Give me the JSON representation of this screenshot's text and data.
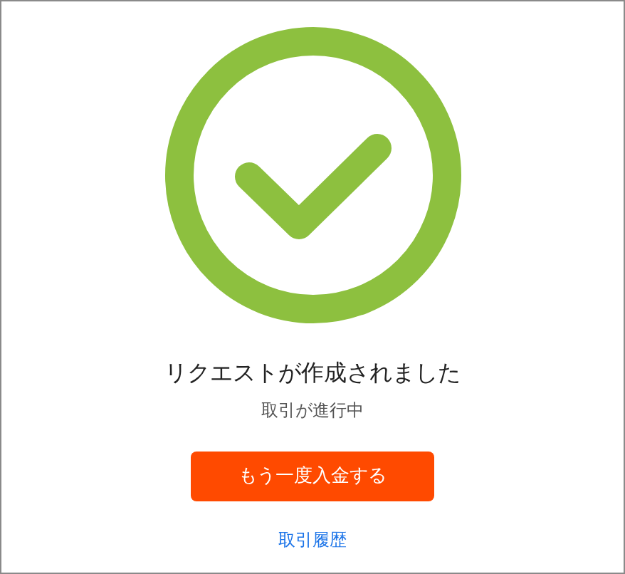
{
  "title": "リクエストが作成されました",
  "subtitle": "取引が進行中",
  "button": {
    "label": "もう一度入金する"
  },
  "link": {
    "label": "取引履歴"
  }
}
